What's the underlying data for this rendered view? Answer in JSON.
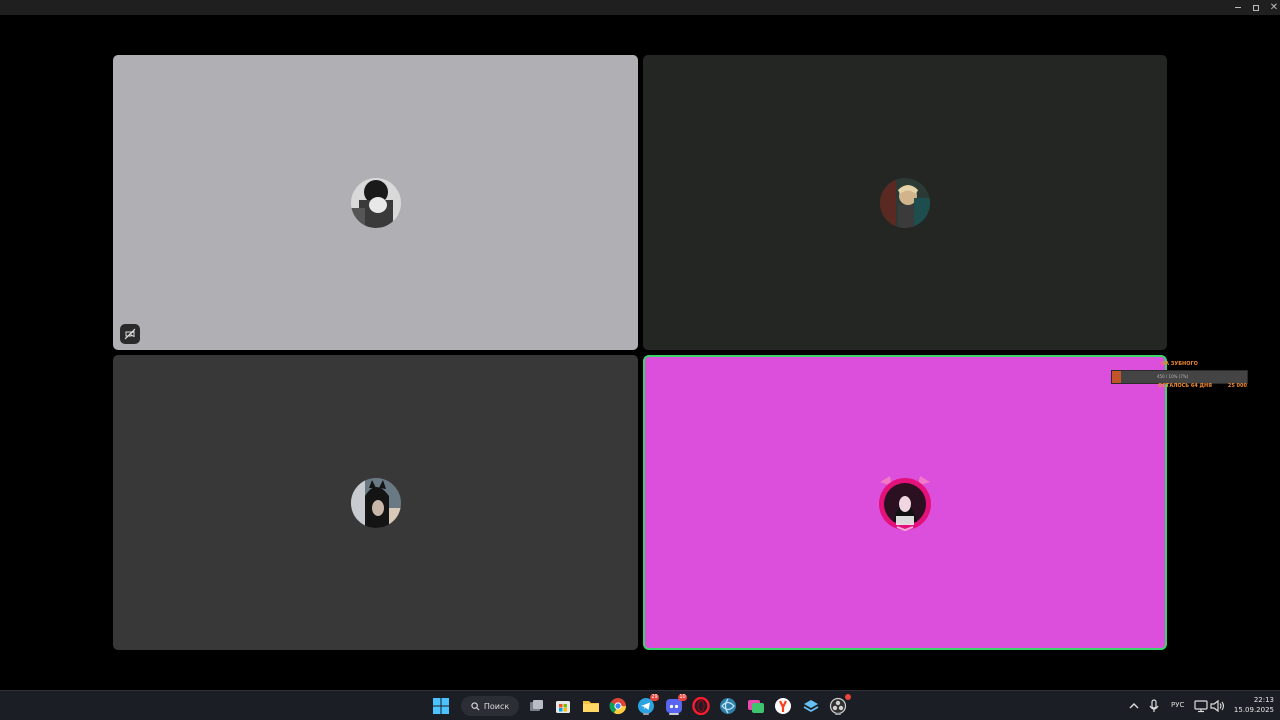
{
  "window": {
    "controls": {
      "minimize": "minimize-icon",
      "maximize": "maximize-icon",
      "close": "close-icon"
    }
  },
  "tiles": [
    {
      "background": "#b0afb3",
      "avatar": "avatar-user-1",
      "muted_video": true
    },
    {
      "background": "#232622",
      "avatar": "avatar-user-2",
      "muted_video": false
    },
    {
      "background": "#383838",
      "avatar": "avatar-user-3",
      "muted_video": false
    },
    {
      "background": "#dc4edc",
      "avatar": "avatar-user-4",
      "muted_video": false,
      "speaking_border": "#3bd36a"
    }
  ],
  "goal_widget": {
    "title": "НА ЗУБНОГО",
    "bar_text": "450 / 10% (7%)",
    "progress": 0.07,
    "remaining": "ОСТАЛОСЬ 64 ДНЯ",
    "amount": "25 000"
  },
  "taskbar": {
    "search_label": "Поиск",
    "apps": [
      {
        "name": "windows-start-icon"
      },
      {
        "name": "task-view-icon"
      },
      {
        "name": "microsoft-store-icon"
      },
      {
        "name": "file-explorer-icon"
      },
      {
        "name": "chrome-icon"
      },
      {
        "name": "telegram-icon",
        "badge": "29"
      },
      {
        "name": "discord-icon",
        "badge": "10"
      },
      {
        "name": "opera-icon"
      },
      {
        "name": "browser-icon"
      },
      {
        "name": "chat-app-icon"
      },
      {
        "name": "yandex-browser-icon"
      },
      {
        "name": "steam-icon"
      },
      {
        "name": "obs-icon"
      }
    ],
    "tray": {
      "chevron": "chevron-up-icon",
      "mic": "microphone-icon",
      "language": "РУС",
      "network": "network-icon",
      "volume": "volume-icon"
    },
    "clock": {
      "time": "22:13",
      "date": "15.09.2025"
    }
  }
}
